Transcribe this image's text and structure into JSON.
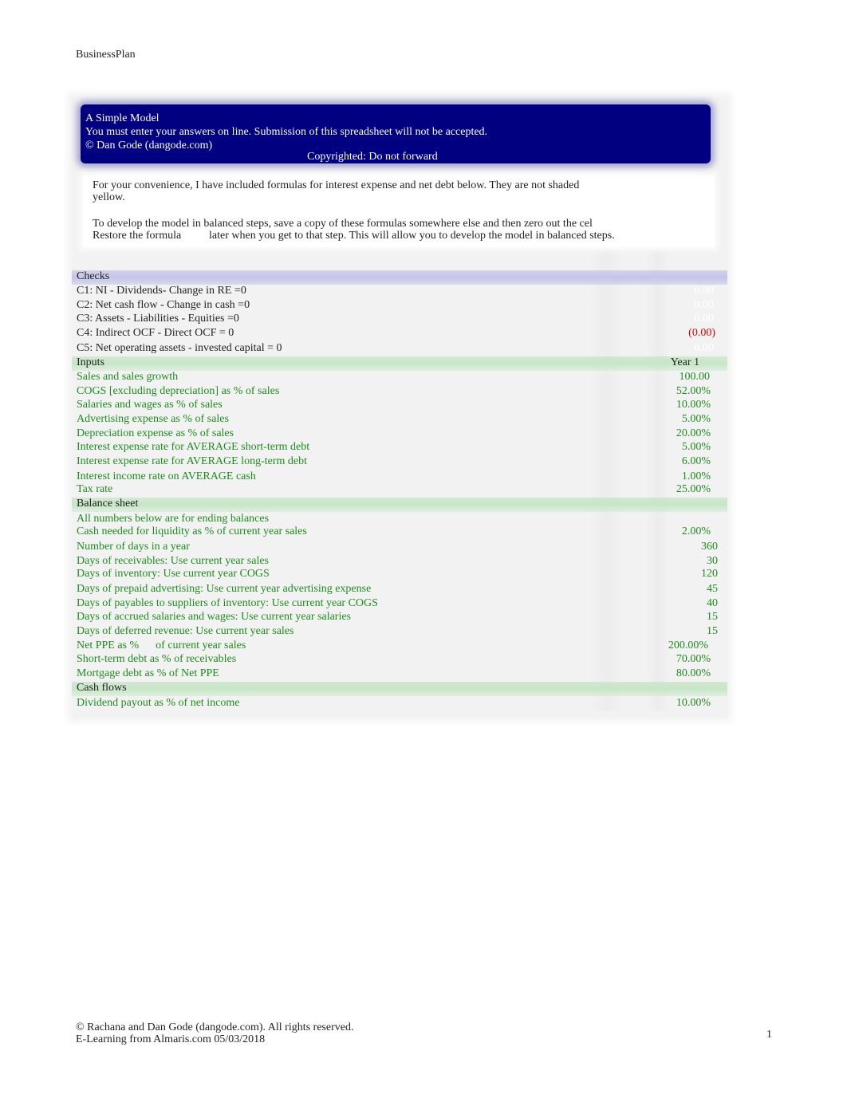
{
  "header": {
    "title": "BusinessPlan"
  },
  "banner": {
    "title": "A Simple Model",
    "notice": "You must enter your answers on line. Submission of this spreadsheet will not be accepted.",
    "author": "© Dan Gode (dangode.com)",
    "copyright": "Copyrighted: Do not forward",
    "background_color": "#000080"
  },
  "note": {
    "line1": "For your convenience, I have included formulas for interest expense and net debt below. They are not shaded",
    "line2": "yellow.",
    "line3": "To develop the model in balanced steps, save a copy of these formulas somewhere else and then zero out the cel",
    "line4a": "Restore the formula",
    "line4b": "later when you get to that step. This will allow you to develop the model in balanced steps."
  },
  "checks": {
    "heading": "Checks",
    "items": [
      {
        "label": "C1: NI - Dividends- Change in RE =0",
        "value": "0.00",
        "status": "ok"
      },
      {
        "label": "C2: Net cash flow - Change in cash =0",
        "value": "0.00",
        "status": "ok"
      },
      {
        "label": "C3: Assets - Liabilities - Equities =0",
        "value": "0.00",
        "status": "ok"
      },
      {
        "label": "C4: Indirect OCF - Direct OCF = 0",
        "value": "(0.00)",
        "status": "negative"
      },
      {
        "label": "C5: Net operating assets - invested capital = 0",
        "value": "0.00",
        "status": "ok"
      }
    ]
  },
  "inputs": {
    "heading": "Inputs",
    "column_header": "Year 1",
    "items": [
      {
        "label": "Sales and sales growth",
        "value": "100.00"
      },
      {
        "label": "COGS [excluding depreciation] as % of sales",
        "value": "52.00%"
      },
      {
        "label": "Salaries and wages as % of sales",
        "value": "10.00%"
      },
      {
        "label": "Advertising expense as % of sales",
        "value": "5.00%"
      },
      {
        "label": "Depreciation expense as % of sales",
        "value": "20.00%"
      },
      {
        "label": "Interest expense rate for AVERAGE short-term debt",
        "value": "5.00%"
      },
      {
        "label": "Interest expense rate for AVERAGE long-term debt",
        "value": "6.00%"
      },
      {
        "label": "Interest income rate on AVERAGE cash",
        "value": "1.00%"
      },
      {
        "label": "Tax rate",
        "value": "25.00%"
      }
    ]
  },
  "balance_sheet": {
    "heading": "Balance sheet",
    "subheading": "All numbers below are for ending balances",
    "items": [
      {
        "label": "Cash needed for liquidity as % of current year sales",
        "value": "2.00%"
      },
      {
        "label": "Number of days in a year",
        "value": "360"
      },
      {
        "label": "Days of receivables: Use current year sales",
        "value": "30"
      },
      {
        "label": "Days of inventory: Use current year COGS",
        "value": "120"
      },
      {
        "label": "Days of prepaid advertising: Use current year advertising expense",
        "value": "45"
      },
      {
        "label": "Days of payables to suppliers of inventory: Use current year COGS",
        "value": "40"
      },
      {
        "label": "Days of accrued salaries and wages: Use current year salaries",
        "value": "15"
      },
      {
        "label": "Days of deferred revenue: Use current year sales",
        "value": "15"
      },
      {
        "label": "Net PPE as %      of current year sales",
        "value": "200.00%"
      },
      {
        "label": "Short-term debt as % of receivables",
        "value": "70.00%"
      },
      {
        "label": "Mortgage debt as % of Net PPE",
        "value": "80.00%"
      }
    ]
  },
  "cash_flows": {
    "heading": "Cash flows",
    "items": [
      {
        "label": "Dividend payout as % of net income",
        "value": "10.00%"
      }
    ]
  },
  "footer": {
    "line1": "© Rachana and Dan Gode (dangode.com). All rights reserved.",
    "line2": "E-Learning from Almaris.com 05/03/2018",
    "page_number": "1"
  },
  "colors": {
    "input_text": "#1e8c1e",
    "negative": "#e00000",
    "checks_band": "#c4c4ea",
    "section_band": "#c7e6c7"
  }
}
